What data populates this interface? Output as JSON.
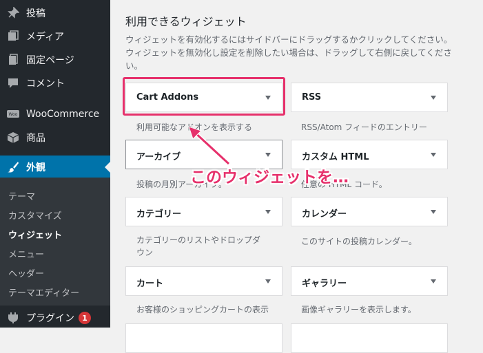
{
  "sidebar": {
    "items": [
      {
        "label": "投稿",
        "icon": "pin-icon"
      },
      {
        "label": "メディア",
        "icon": "media-icon"
      },
      {
        "label": "固定ページ",
        "icon": "page-icon"
      },
      {
        "label": "コメント",
        "icon": "comment-icon"
      },
      {
        "label": "WooCommerce",
        "icon": "woo-icon"
      },
      {
        "label": "商品",
        "icon": "box-icon"
      },
      {
        "label": "外観",
        "icon": "brush-icon"
      },
      {
        "label": "プラグイン",
        "icon": "plugin-icon",
        "badge": "1"
      }
    ],
    "submenu": [
      "テーマ",
      "カスタマイズ",
      "ウィジェット",
      "メニュー",
      "ヘッダー",
      "テーマエディター"
    ]
  },
  "main": {
    "heading": "利用できるウィジェット",
    "description": "ウィジェットを有効化するにはサイドバーにドラッグするかクリックしてください。ウィジェットを無効化し設定を削除したい場合は、ドラッグして右側に戻してください。",
    "widgets": [
      {
        "title": "Cart Addons",
        "desc": "利用可能なアドオンを表示する"
      },
      {
        "title": "RSS",
        "desc": "RSS/Atom フィードのエントリー"
      },
      {
        "title": "アーカイブ",
        "desc": "投稿の月別アーカイブ。"
      },
      {
        "title": "カスタム HTML",
        "desc": "任意の HTML コード。"
      },
      {
        "title": "カテゴリー",
        "desc": "カテゴリーのリストやドロップダウン"
      },
      {
        "title": "カレンダー",
        "desc": "このサイトの投稿カレンダー。"
      },
      {
        "title": "カート",
        "desc": "お客様のショッピングカートの表示"
      },
      {
        "title": "ギャラリー",
        "desc": "画像ギャラリーを表示します。"
      }
    ]
  },
  "annotation": {
    "text": "このウィジェットを…",
    "color": "#e6306b"
  },
  "colors": {
    "sidebar": "#23282d",
    "active": "#0073aa",
    "accent": "#e6306b"
  }
}
